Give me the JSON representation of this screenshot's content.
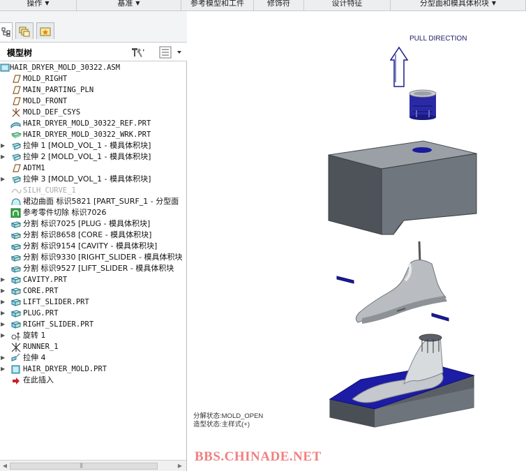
{
  "menubar": {
    "items": [
      {
        "label": "操作",
        "caret": "▼"
      },
      {
        "label": "基准",
        "caret": "▼"
      },
      {
        "label": "参考模型和工件",
        "caret": ""
      },
      {
        "label": "修饰符",
        "caret": ""
      },
      {
        "label": "设计特征",
        "caret": ""
      },
      {
        "label": "分型面和模具体积块",
        "caret": "▼"
      }
    ]
  },
  "panel": {
    "title": "模型树",
    "tabs": [
      "model-tree-tab",
      "layers-tab",
      "favorites-tab"
    ]
  },
  "tree": {
    "items": [
      {
        "label": "HAIR_DRYER_MOLD_30322.ASM",
        "icon": "assembly",
        "expander": ""
      },
      {
        "label": "MOLD_RIGHT",
        "icon": "datum-plane",
        "expander": ""
      },
      {
        "label": "MAIN_PARTING_PLN",
        "icon": "datum-plane",
        "expander": ""
      },
      {
        "label": "MOLD_FRONT",
        "icon": "datum-plane",
        "expander": ""
      },
      {
        "label": "MOLD_DEF_CSYS",
        "icon": "csys",
        "expander": ""
      },
      {
        "label": "HAIR_DRYER_MOLD_30322_REF.PRT",
        "icon": "ref-part",
        "expander": ""
      },
      {
        "label": "HAIR_DRYER_MOLD_30322_WRK.PRT",
        "icon": "workpiece",
        "expander": ""
      },
      {
        "label": "拉伸 1 [MOLD_VOL_1 - 模具体积块]",
        "icon": "extrude",
        "expander": "▶"
      },
      {
        "label": "拉伸 2 [MOLD_VOL_1 - 模具体积块]",
        "icon": "extrude",
        "expander": "▶"
      },
      {
        "label": "ADTM1",
        "icon": "datum-plane",
        "expander": ""
      },
      {
        "label": "拉伸 3 [MOLD_VOL_1 - 模具体积块]",
        "icon": "extrude",
        "expander": "▶"
      },
      {
        "label": "SILH_CURVE_1",
        "icon": "curve",
        "expander": "",
        "grey": true
      },
      {
        "label": "裙边曲面 标识5821 [PART_SURF_1 - 分型面",
        "icon": "skirt",
        "expander": ""
      },
      {
        "label": "参考零件切除 标识7026",
        "icon": "refcut",
        "expander": ""
      },
      {
        "label": "分割 标识7025 [PLUG - 模具体积块]",
        "icon": "split",
        "expander": ""
      },
      {
        "label": "分割 标识8658 [CORE - 模具体积块]",
        "icon": "split",
        "expander": ""
      },
      {
        "label": "分割 标识9154 [CAVITY - 模具体积块]",
        "icon": "split",
        "expander": ""
      },
      {
        "label": "分割 标识9330 [RIGHT_SLIDER - 模具体积块",
        "icon": "split",
        "expander": ""
      },
      {
        "label": "分割 标识9527 [LIFT_SLIDER - 模具体积块",
        "icon": "split",
        "expander": ""
      },
      {
        "label": "CAVITY.PRT",
        "icon": "part",
        "expander": "▶"
      },
      {
        "label": "CORE.PRT",
        "icon": "part",
        "expander": "▶"
      },
      {
        "label": "LIFT_SLIDER.PRT",
        "icon": "part",
        "expander": "▶"
      },
      {
        "label": "PLUG.PRT",
        "icon": "part",
        "expander": "▶"
      },
      {
        "label": "RIGHT_SLIDER.PRT",
        "icon": "part",
        "expander": "▶"
      },
      {
        "label": "旋转 1",
        "icon": "revolve",
        "expander": "▶"
      },
      {
        "label": "RUNNER_1",
        "icon": "runner",
        "expander": ""
      },
      {
        "label": "拉伸 4",
        "icon": "extrude-small",
        "expander": "▶"
      },
      {
        "label": "HAIR_DRYER_MOLD.PRT",
        "icon": "part-solid",
        "expander": "▶"
      },
      {
        "label": "在此插入",
        "icon": "insert-arrow",
        "expander": ""
      }
    ]
  },
  "viewport": {
    "pull_direction": "PULL DIRECTION",
    "status_line_1": "分解状态:MOLD_OPEN",
    "status_line_2": "造型状态:主样式(+)",
    "watermark": "BBS.CHINADE.NET"
  },
  "colors": {
    "mold_blue": "#1a1aa8",
    "mold_grey": "#5a5f66",
    "part_silver": "#b8bcc0",
    "watermark": "#f08080"
  }
}
